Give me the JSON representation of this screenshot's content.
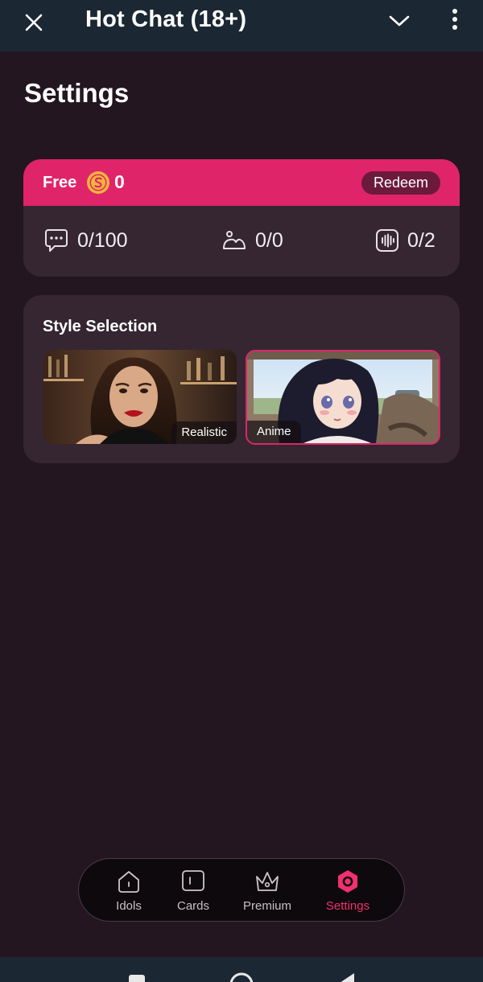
{
  "app": {
    "title": "Hot Chat (18+)"
  },
  "icons": {
    "close": "close-icon",
    "dropdown": "chevron-down-icon",
    "more": "more-vertical-icon"
  },
  "page": {
    "title": "Settings"
  },
  "plan": {
    "name": "Free",
    "coins": "0",
    "redeem_label": "Redeem",
    "accent_color": "#e0246a",
    "stats": {
      "messages": "0/100",
      "images": "0/0",
      "voice": "0/2"
    }
  },
  "style_selection": {
    "title": "Style Selection",
    "options": [
      {
        "label": "Realistic",
        "selected": false
      },
      {
        "label": "Anime",
        "selected": true
      }
    ]
  },
  "bottom_nav": {
    "items": [
      {
        "label": "Idols",
        "icon": "home-icon",
        "active": false
      },
      {
        "label": "Cards",
        "icon": "card-icon",
        "active": false
      },
      {
        "label": "Premium",
        "icon": "crown-icon",
        "active": false
      },
      {
        "label": "Settings",
        "icon": "gear-icon",
        "active": true
      }
    ],
    "active_color": "#f0306f"
  }
}
